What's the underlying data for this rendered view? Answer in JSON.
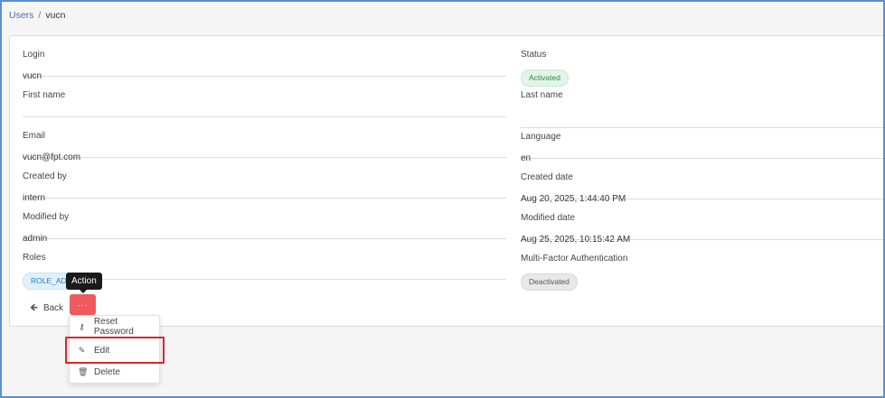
{
  "breadcrumb": {
    "parent": "Users",
    "separator": "/",
    "current": "vucn"
  },
  "fields_left": {
    "login": {
      "label": "Login",
      "value": "vucn"
    },
    "first_name": {
      "label": "First name",
      "value": ""
    },
    "email": {
      "label": "Email",
      "value": "vucn@fpt.com"
    },
    "created_by": {
      "label": "Created by",
      "value": "intern"
    },
    "modified_by": {
      "label": "Modified by",
      "value": "admin"
    },
    "roles": {
      "label": "Roles",
      "value": "ROLE_ADM"
    }
  },
  "fields_right": {
    "status": {
      "label": "Status",
      "value": "Activated"
    },
    "last_name": {
      "label": "Last name",
      "value": ""
    },
    "language": {
      "label": "Language",
      "value": "en"
    },
    "created_date": {
      "label": "Created date",
      "value": "Aug 20, 2025, 1:44:40 PM"
    },
    "modified_date": {
      "label": "Modified date",
      "value": "Aug 25, 2025, 10:15:42 AM"
    },
    "mfa": {
      "label": "Multi-Factor Authentication",
      "value": "Deactivated"
    }
  },
  "actions": {
    "back_label": "Back",
    "more_label": "···",
    "tooltip": "Action"
  },
  "menu": {
    "items": [
      {
        "label": "Reset Password",
        "icon": "key-icon"
      },
      {
        "label": "Edit",
        "icon": "pencil-icon"
      },
      {
        "label": "Delete",
        "icon": "trash-icon"
      }
    ]
  },
  "colors": {
    "accent_button": "#ef5a60",
    "highlight_border": "#d8262d",
    "frame_border": "#5b8fd0",
    "status_active": "#2f8a45"
  }
}
